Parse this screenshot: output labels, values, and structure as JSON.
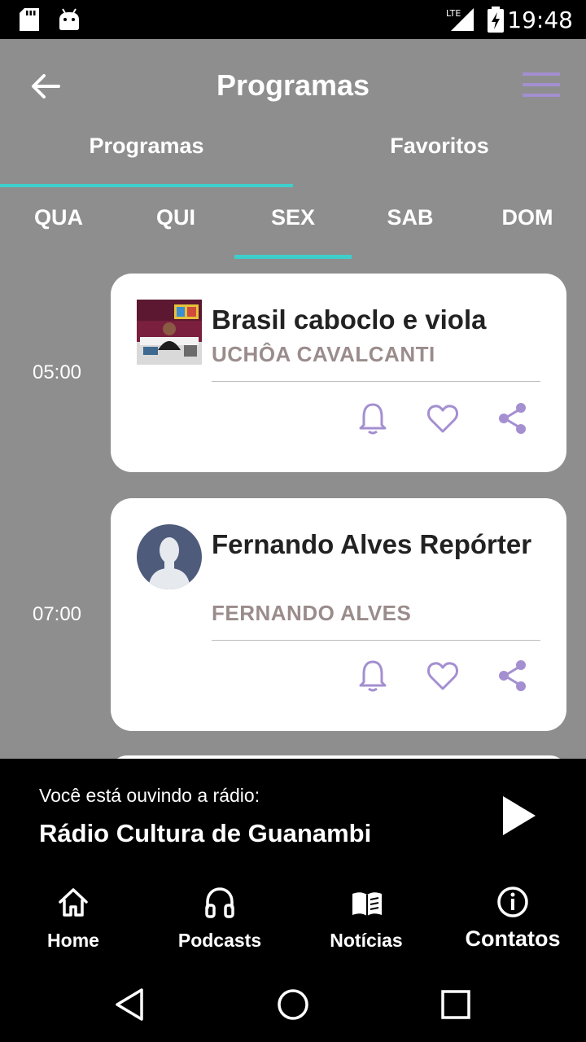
{
  "status_bar": {
    "time": "19:48",
    "network": "LTE"
  },
  "header": {
    "title": "Programas"
  },
  "main_tabs": [
    {
      "label": "Programas",
      "active": true
    },
    {
      "label": "Favoritos",
      "active": false
    }
  ],
  "days": [
    {
      "label": "QUA",
      "active": false
    },
    {
      "label": "QUI",
      "active": false
    },
    {
      "label": "SEX",
      "active": true
    },
    {
      "label": "SAB",
      "active": false
    },
    {
      "label": "DOM",
      "active": false
    }
  ],
  "programs": [
    {
      "time": "05:00",
      "title": "Brasil caboclo e viola",
      "host": "UCHÔA CAVALCANTI"
    },
    {
      "time": "07:00",
      "title": "Fernando Alves Repórter",
      "host": "FERNANDO ALVES"
    }
  ],
  "player": {
    "label": "Você está ouvindo a rádio:",
    "station": "Rádio Cultura de Guanambi"
  },
  "nav": [
    {
      "label": "Home",
      "icon": "home-icon"
    },
    {
      "label": "Podcasts",
      "icon": "headphones-icon"
    },
    {
      "label": "Notícias",
      "icon": "book-icon"
    },
    {
      "label": "Contatos",
      "icon": "info-icon",
      "active": true
    }
  ],
  "colors": {
    "accent": "#3ecfcb",
    "icon_purple": "#a48fd1",
    "background": "#8e8e8e",
    "host_text": "#9b8c8c"
  }
}
